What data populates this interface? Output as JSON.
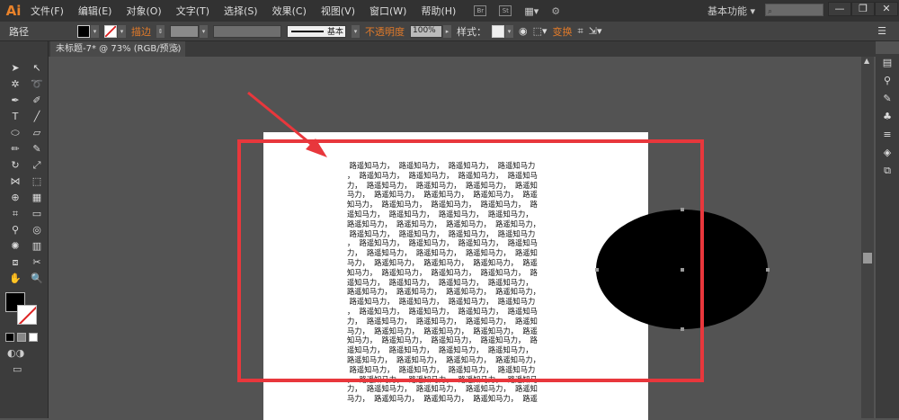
{
  "app": {
    "logo": "Ai",
    "menu": [
      "文件(F)",
      "编辑(E)",
      "对象(O)",
      "文字(T)",
      "选择(S)",
      "效果(C)",
      "视图(V)",
      "窗口(W)",
      "帮助(H)"
    ],
    "br_icon": "Br",
    "st_icon": "St",
    "workspace": "基本功能",
    "win_min": "—",
    "win_restore": "❐",
    "win_close": "✕"
  },
  "control": {
    "selection": "路径",
    "stroke_label": "描边",
    "stroke_style": "基本",
    "opacity_label": "不透明度",
    "opacity_value": "100%",
    "style_label": "样式：",
    "transform_label": "变换"
  },
  "document": {
    "tab_title": "未标题-7* @ 73% (RGB/预览)",
    "tab_close": "×"
  },
  "text_lines": [
    " 路遥知马力，  路遥知马力，  路遥知马力，  路遥知马力",
    "，  路遥知马力，  路遥知马力，  路遥知马力，  路遥知马",
    "力，  路遥知马力，  路遥知马力，  路遥知马力，  路遥知",
    "马力，  路遥知马力，  路遥知马力，  路遥知马力，  路遥",
    "知马力，  路遥知马力，  路遥知马力，  路遥知马力，  路",
    "遥知马力，  路遥知马力，  路遥知马力，  路遥知马力，",
    "路遥知马力，  路遥知马力，  路遥知马力，  路遥知马力，",
    " 路遥知马力，  路遥知马力，  路遥知马力，  路遥知马力",
    "，  路遥知马力，  路遥知马力，  路遥知马力，  路遥知马",
    "力，  路遥知马力，  路遥知马力，  路遥知马力，  路遥知",
    "马力，  路遥知马力，  路遥知马力，  路遥知马力，  路遥",
    "知马力，  路遥知马力，  路遥知马力，  路遥知马力，  路",
    "遥知马力，  路遥知马力，  路遥知马力，  路遥知马力，",
    "路遥知马力，  路遥知马力，  路遥知马力，  路遥知马力，",
    " 路遥知马力，  路遥知马力，  路遥知马力，  路遥知马力",
    "，  路遥知马力，  路遥知马力，  路遥知马力，  路遥知马",
    "力，  路遥知马力，  路遥知马力，  路遥知马力，  路遥知",
    "马力，  路遥知马力，  路遥知马力，  路遥知马力，  路遥",
    "知马力，  路遥知马力，  路遥知马力，  路遥知马力，  路",
    "遥知马力，  路遥知马力，  路遥知马力，  路遥知马力，",
    "路遥知马力，  路遥知马力，  路遥知马力，  路遥知马力，",
    " 路遥知马力，  路遥知马力，  路遥知马力，  路遥知马力",
    "，  路遥知马力，  路遥知马力，  路遥知马力，  路遥知马",
    "力，  路遥知马力，  路遥知马力，  路遥知马力，  路遥知",
    "马力，  路遥知马力，  路遥知马力，  路遥知马力，  路遥"
  ],
  "colors": {
    "highlight": "#e8373c",
    "accent": "#e07a2a"
  }
}
